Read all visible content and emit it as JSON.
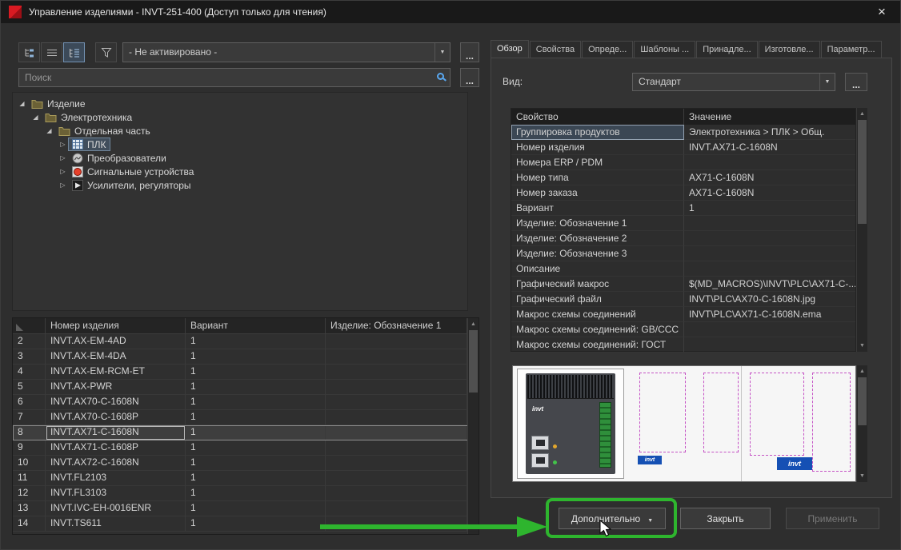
{
  "window": {
    "title": "Управление изделиями - INVT-251-400 (Доступ только для чтения)",
    "close_glyph": "×"
  },
  "colors": {
    "annotation_green": "#2eb52e",
    "selection_blue": "#414e5c"
  },
  "left": {
    "toolbar": {
      "icons": [
        "tree-view",
        "list-view",
        "tree-table-view",
        "filter"
      ],
      "active_icon": "tree-table-view",
      "scheme_value": "- Не активировано -",
      "more_label": "..."
    },
    "search": {
      "placeholder": "Поиск",
      "more_label": "..."
    },
    "tree": [
      {
        "id": "product",
        "label": "Изделие",
        "level": 0,
        "icon": "folder",
        "expanded": true
      },
      {
        "id": "electrical",
        "label": "Электротехника",
        "level": 1,
        "icon": "folder",
        "expanded": true
      },
      {
        "id": "separate-part",
        "label": "Отдельная часть",
        "level": 2,
        "icon": "folder",
        "expanded": true
      },
      {
        "id": "plc",
        "label": "ПЛК",
        "level": 3,
        "icon": "plc",
        "expanded": false,
        "selected": true
      },
      {
        "id": "converters",
        "label": "Преобразователи",
        "level": 3,
        "icon": "converter",
        "expanded": false
      },
      {
        "id": "signal-devices",
        "label": "Сигнальные устройства",
        "level": 3,
        "icon": "signal",
        "expanded": false
      },
      {
        "id": "amplifiers",
        "label": "Усилители, регуляторы",
        "level": 3,
        "icon": "amplifier",
        "expanded": false
      }
    ],
    "parts_table": {
      "columns": [
        "Номер изделия",
        "Вариант",
        "Изделие: Обозначение 1"
      ],
      "rows": [
        {
          "n": "2",
          "part": "INVT.AX-EM-4AD",
          "variant": "1",
          "designation": ""
        },
        {
          "n": "3",
          "part": "INVT.AX-EM-4DA",
          "variant": "1",
          "designation": ""
        },
        {
          "n": "4",
          "part": "INVT.AX-EM-RCM-ET",
          "variant": "1",
          "designation": ""
        },
        {
          "n": "5",
          "part": "INVT.AX-PWR",
          "variant": "1",
          "designation": ""
        },
        {
          "n": "6",
          "part": "INVT.AX70-C-1608N",
          "variant": "1",
          "designation": ""
        },
        {
          "n": "7",
          "part": "INVT.AX70-C-1608P",
          "variant": "1",
          "designation": ""
        },
        {
          "n": "8",
          "part": "INVT.AX71-C-1608N",
          "variant": "1",
          "designation": "",
          "selected": true
        },
        {
          "n": "9",
          "part": "INVT.AX71-C-1608P",
          "variant": "1",
          "designation": ""
        },
        {
          "n": "10",
          "part": "INVT.AX72-C-1608N",
          "variant": "1",
          "designation": ""
        },
        {
          "n": "11",
          "part": "INVT.FL2103",
          "variant": "1",
          "designation": ""
        },
        {
          "n": "12",
          "part": "INVT.FL3103",
          "variant": "1",
          "designation": ""
        },
        {
          "n": "13",
          "part": "INVT.IVC-EH-0016ENR",
          "variant": "1",
          "designation": ""
        },
        {
          "n": "14",
          "part": "INVT.TS611",
          "variant": "1",
          "designation": ""
        }
      ]
    }
  },
  "right": {
    "tabs": [
      {
        "id": "overview",
        "label": "Обзор",
        "active": true
      },
      {
        "id": "properties",
        "label": "Свойства",
        "active": false
      },
      {
        "id": "definitions",
        "label": "Опреде...",
        "active": false
      },
      {
        "id": "templates",
        "label": "Шаблоны ...",
        "active": false
      },
      {
        "id": "accessories",
        "label": "Принадле...",
        "active": false
      },
      {
        "id": "manufacturing",
        "label": "Изготовле...",
        "active": false
      },
      {
        "id": "parameters",
        "label": "Параметр...",
        "active": false
      }
    ],
    "view": {
      "label": "Вид:",
      "value": "Стандарт",
      "more_label": "..."
    },
    "properties": {
      "columns": [
        "Свойство",
        "Значение"
      ],
      "rows": [
        {
          "name": "Группировка продуктов",
          "value": "Электротехника > ПЛК > Общ.",
          "selected": true
        },
        {
          "name": "Номер изделия",
          "value": "INVT.AX71-C-1608N",
          "selected": false
        },
        {
          "name": "Номера ERP / PDM",
          "value": "",
          "selected": false
        },
        {
          "name": "Номер типа",
          "value": "AX71-C-1608N",
          "selected": false
        },
        {
          "name": "Номер заказа",
          "value": "AX71-C-1608N",
          "selected": false
        },
        {
          "name": "Вариант",
          "value": "1",
          "selected": false
        },
        {
          "name": "Изделие: Обозначение 1",
          "value": "",
          "selected": false
        },
        {
          "name": "Изделие: Обозначение 2",
          "value": "",
          "selected": false
        },
        {
          "name": "Изделие: Обозначение 3",
          "value": "",
          "selected": false
        },
        {
          "name": "Описание",
          "value": "",
          "selected": false
        },
        {
          "name": "Графический макрос",
          "value": "$(MD_MACROS)\\INVT\\PLC\\AX71-C-...",
          "selected": false
        },
        {
          "name": "Графический файл",
          "value": "INVT\\PLC\\AX70-C-1608N.jpg",
          "selected": false
        },
        {
          "name": "Макрос схемы соединений",
          "value": "INVT\\PLC\\AX71-C-1608N.ema",
          "selected": false
        },
        {
          "name": "Макрос схемы соединений: GB/CCC",
          "value": "",
          "selected": false
        },
        {
          "name": "Макрос схемы соединений: ГОСТ",
          "value": "",
          "selected": false
        }
      ]
    },
    "preview": {
      "brand_labels": [
        "invt",
        "invt",
        "invt"
      ]
    },
    "buttons": {
      "more": "Дополнительно",
      "close": "Закрыть",
      "apply": "Применить"
    }
  }
}
